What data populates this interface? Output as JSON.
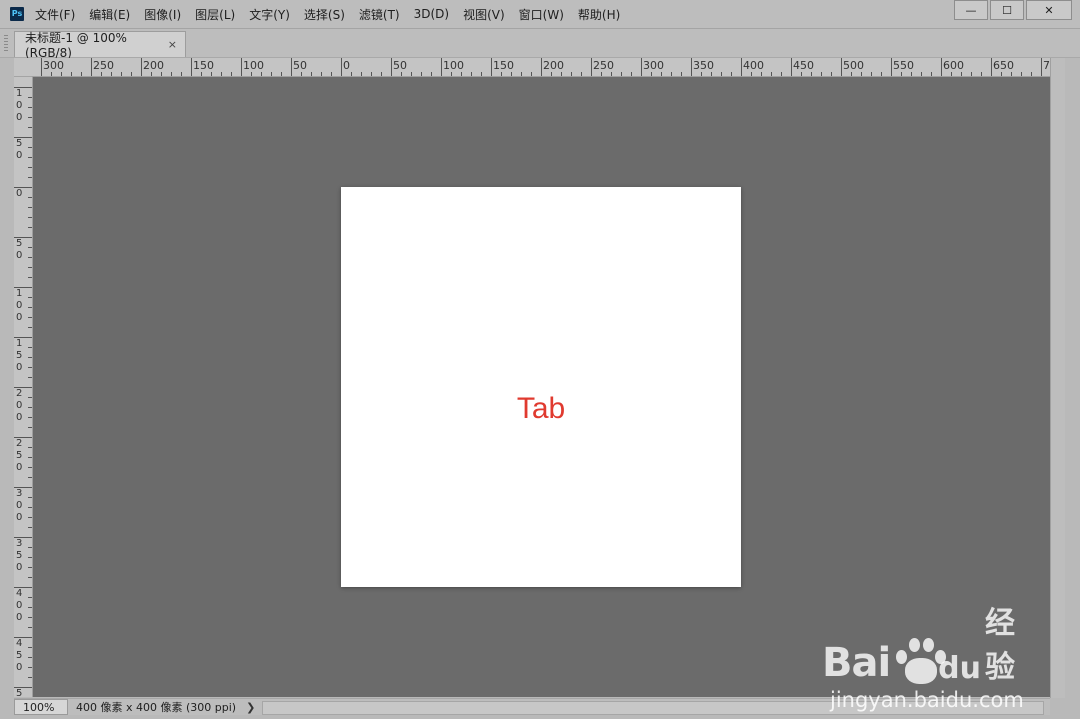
{
  "app": {
    "logo_text": "Ps"
  },
  "menu": {
    "items": [
      "文件(F)",
      "编辑(E)",
      "图像(I)",
      "图层(L)",
      "文字(Y)",
      "选择(S)",
      "滤镜(T)",
      "3D(D)",
      "视图(V)",
      "窗口(W)",
      "帮助(H)"
    ]
  },
  "window_controls": {
    "minimize": "—",
    "maximize": "☐",
    "close": "✕"
  },
  "document_tab": {
    "title": "未标题-1 @ 100%(RGB/8)",
    "close": "×"
  },
  "ruler": {
    "h_labels": [
      "300",
      "250",
      "200",
      "150",
      "100",
      "50",
      "0",
      "50",
      "100",
      "150",
      "200",
      "250",
      "300",
      "350",
      "400",
      "450",
      "500",
      "550",
      "600",
      "650",
      "7"
    ],
    "v_labels": [
      "1\n0\n0",
      "5\n0",
      "0",
      "5\n0",
      "1\n0\n0",
      "1\n5\n0",
      "2\n0\n0",
      "2\n5\n0",
      "3\n0\n0",
      "3\n5\n0",
      "4\n0\n0",
      "4\n5\n0",
      "5"
    ]
  },
  "canvas": {
    "text": "Tab",
    "text_color": "#e03a2f",
    "background": "#ffffff"
  },
  "status": {
    "zoom": "100%",
    "doc_info": "400 像素 x 400 像素 (300 ppi)",
    "arrow": "❯"
  },
  "watermark": {
    "brand_latin_1": "Bai",
    "brand_latin_2": "du",
    "brand_cn": "经验",
    "url": "jingyan.baidu.com"
  },
  "colors": {
    "workspace": "#6b6b6b",
    "chrome": "#bdbdbd",
    "ruler": "#c4c4c4"
  }
}
